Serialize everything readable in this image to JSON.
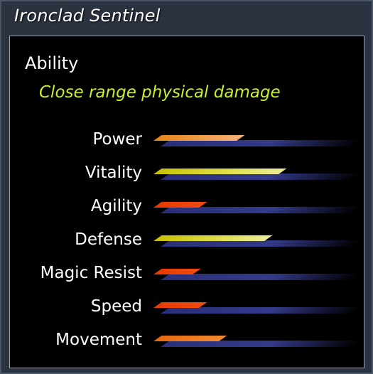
{
  "window": {
    "title": "Ironclad Sentinel"
  },
  "ability": {
    "label": "Ability",
    "description": "Close range physical damage"
  },
  "stats": [
    {
      "label": "Power",
      "value": 0.53,
      "color_style": "orange-peach"
    },
    {
      "label": "Vitality",
      "value": 0.8,
      "color_style": "yellow"
    },
    {
      "label": "Agility",
      "value": 0.29,
      "color_style": "red-orange"
    },
    {
      "label": "Defense",
      "value": 0.71,
      "color_style": "yellow"
    },
    {
      "label": "Magic Resist",
      "value": 0.25,
      "color_style": "red-orange"
    },
    {
      "label": "Speed",
      "value": 0.29,
      "color_style": "red-orange"
    },
    {
      "label": "Movement",
      "value": 0.42,
      "color_style": "orange"
    }
  ],
  "colors": {
    "title_bar_bg": "#2b3340",
    "panel_bg": "#000000",
    "ability_text": "#c8f026",
    "track": "#343a8a"
  }
}
